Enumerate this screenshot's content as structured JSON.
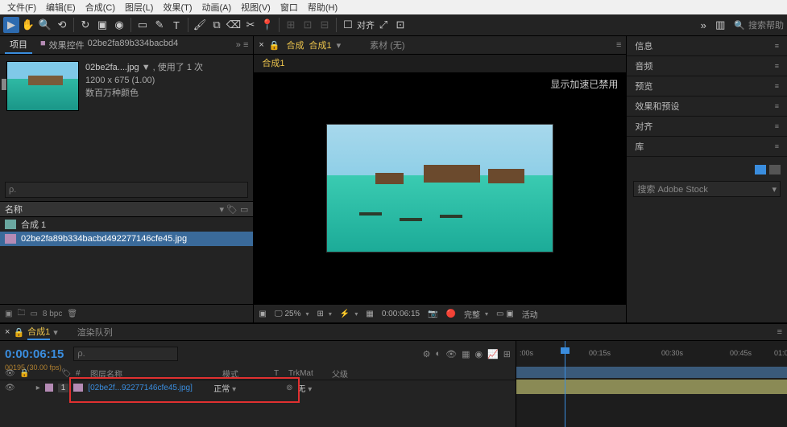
{
  "menu": {
    "file": "文件(F)",
    "edit": "编辑(E)",
    "comp": "合成(C)",
    "layer": "图层(L)",
    "effect": "效果(T)",
    "anim": "动画(A)",
    "view": "视图(V)",
    "window": "窗口",
    "help": "帮助(H)"
  },
  "toolbar": {
    "align": "对齐",
    "search_placeholder": "搜索帮助"
  },
  "project": {
    "tab_project": "项目",
    "tab_effects": "效果控件",
    "tab_effects_file": "02be2fa89b334bacbd4",
    "filename": "02be2fa....jpg",
    "used": "▼ , 使用了 1 次",
    "dims": "1200 x 675 (1.00)",
    "colors": "数百万种颜色",
    "search_placeholder": "ρ.",
    "col_name": "名称",
    "items": [
      {
        "name": "合成 1",
        "type": "comp"
      },
      {
        "name": "02be2fa89b334bacbd492277146cfe45.jpg",
        "type": "img",
        "selected": true
      }
    ],
    "footer_bpc": "8 bpc"
  },
  "composition": {
    "tab_prefix": "合成",
    "tab_name": "合成1",
    "src_label": "素材",
    "src_none": "(无)",
    "crumb": "合成1",
    "accel_msg": "显示加速已禁用",
    "footer": {
      "zoom": "25%",
      "time": "0:00:06:15",
      "quality": "完整",
      "active": "活动"
    }
  },
  "panels": {
    "info": "信息",
    "audio": "音频",
    "preview": "预览",
    "effects": "效果和预设",
    "align": "对齐",
    "library": "库"
  },
  "library": {
    "search_placeholder": "搜索 Adobe Stock"
  },
  "timeline": {
    "tab_name": "合成1",
    "tab_render": "渲染队列",
    "timecode": "0:00:06:15",
    "fps": "00195 (30.00 fps)",
    "search_placeholder": "ρ.",
    "cols": {
      "num": "#",
      "layer": "图层名称",
      "mode": "模式",
      "t": "T",
      "trkmat": "TrkMat",
      "parent": "父级"
    },
    "layer": {
      "idx": "1",
      "name": "[02be2f...92277146cfe45.jpg]",
      "mode": "正常",
      "parent": "无"
    },
    "ruler": {
      "t0": ":00s",
      "t1": "00:15s",
      "t2": "00:30s",
      "t3": "00:45s",
      "t4": "01:0"
    }
  }
}
